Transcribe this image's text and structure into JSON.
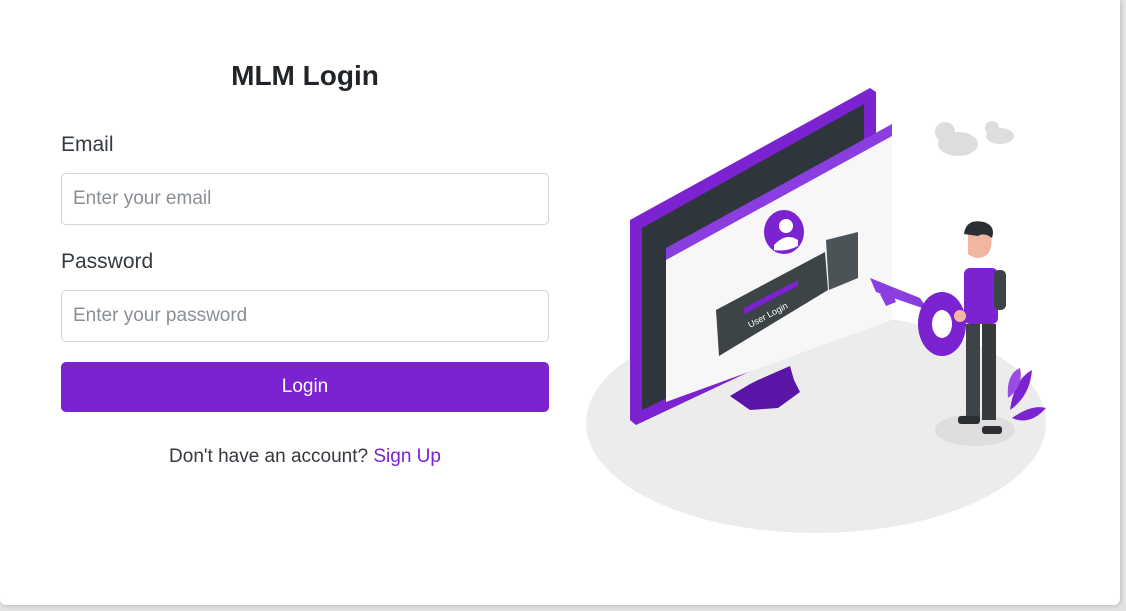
{
  "login": {
    "title": "MLM Login",
    "email_label": "Email",
    "email_placeholder": "Enter your email",
    "email_value": "",
    "password_label": "Password",
    "password_placeholder": "Enter your password",
    "password_value": "",
    "submit_label": "Login",
    "signup_prompt": "Don't have an account?",
    "signup_link": "Sign Up"
  },
  "illustration": {
    "screen_text": "User Login",
    "icon": "user-login-key-illustration"
  },
  "colors": {
    "accent": "#7b22d1",
    "background": "#ffffff",
    "text": "#212529"
  }
}
